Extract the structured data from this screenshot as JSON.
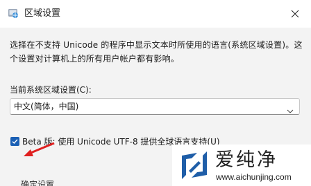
{
  "window": {
    "title": "区域设置",
    "close_icon": "close-icon",
    "title_icon": "globe-settings-icon"
  },
  "main": {
    "description": "选择在不支持 Unicode 的程序中显示文本时所使用的语言(系统区域设置)。这个设置对计算机上的所有用户帐户都有影响。",
    "locale_label": "当前系统区域设置(C):",
    "locale_value": "中文(简体，中国)",
    "beta_checkbox_label": "Beta 版: 使用 Unicode UTF-8 提供全球语言支持(U)",
    "beta_checked": true,
    "partial_bottom_text": "确定设置"
  },
  "watermark": {
    "brand_cn": "爱纯净",
    "url": "www.aichunjing.com"
  },
  "colors": {
    "accent": "#1a5fb4",
    "arrow": "#e02020",
    "background": "#f3f3f3",
    "titlebar": "#ffffff"
  }
}
